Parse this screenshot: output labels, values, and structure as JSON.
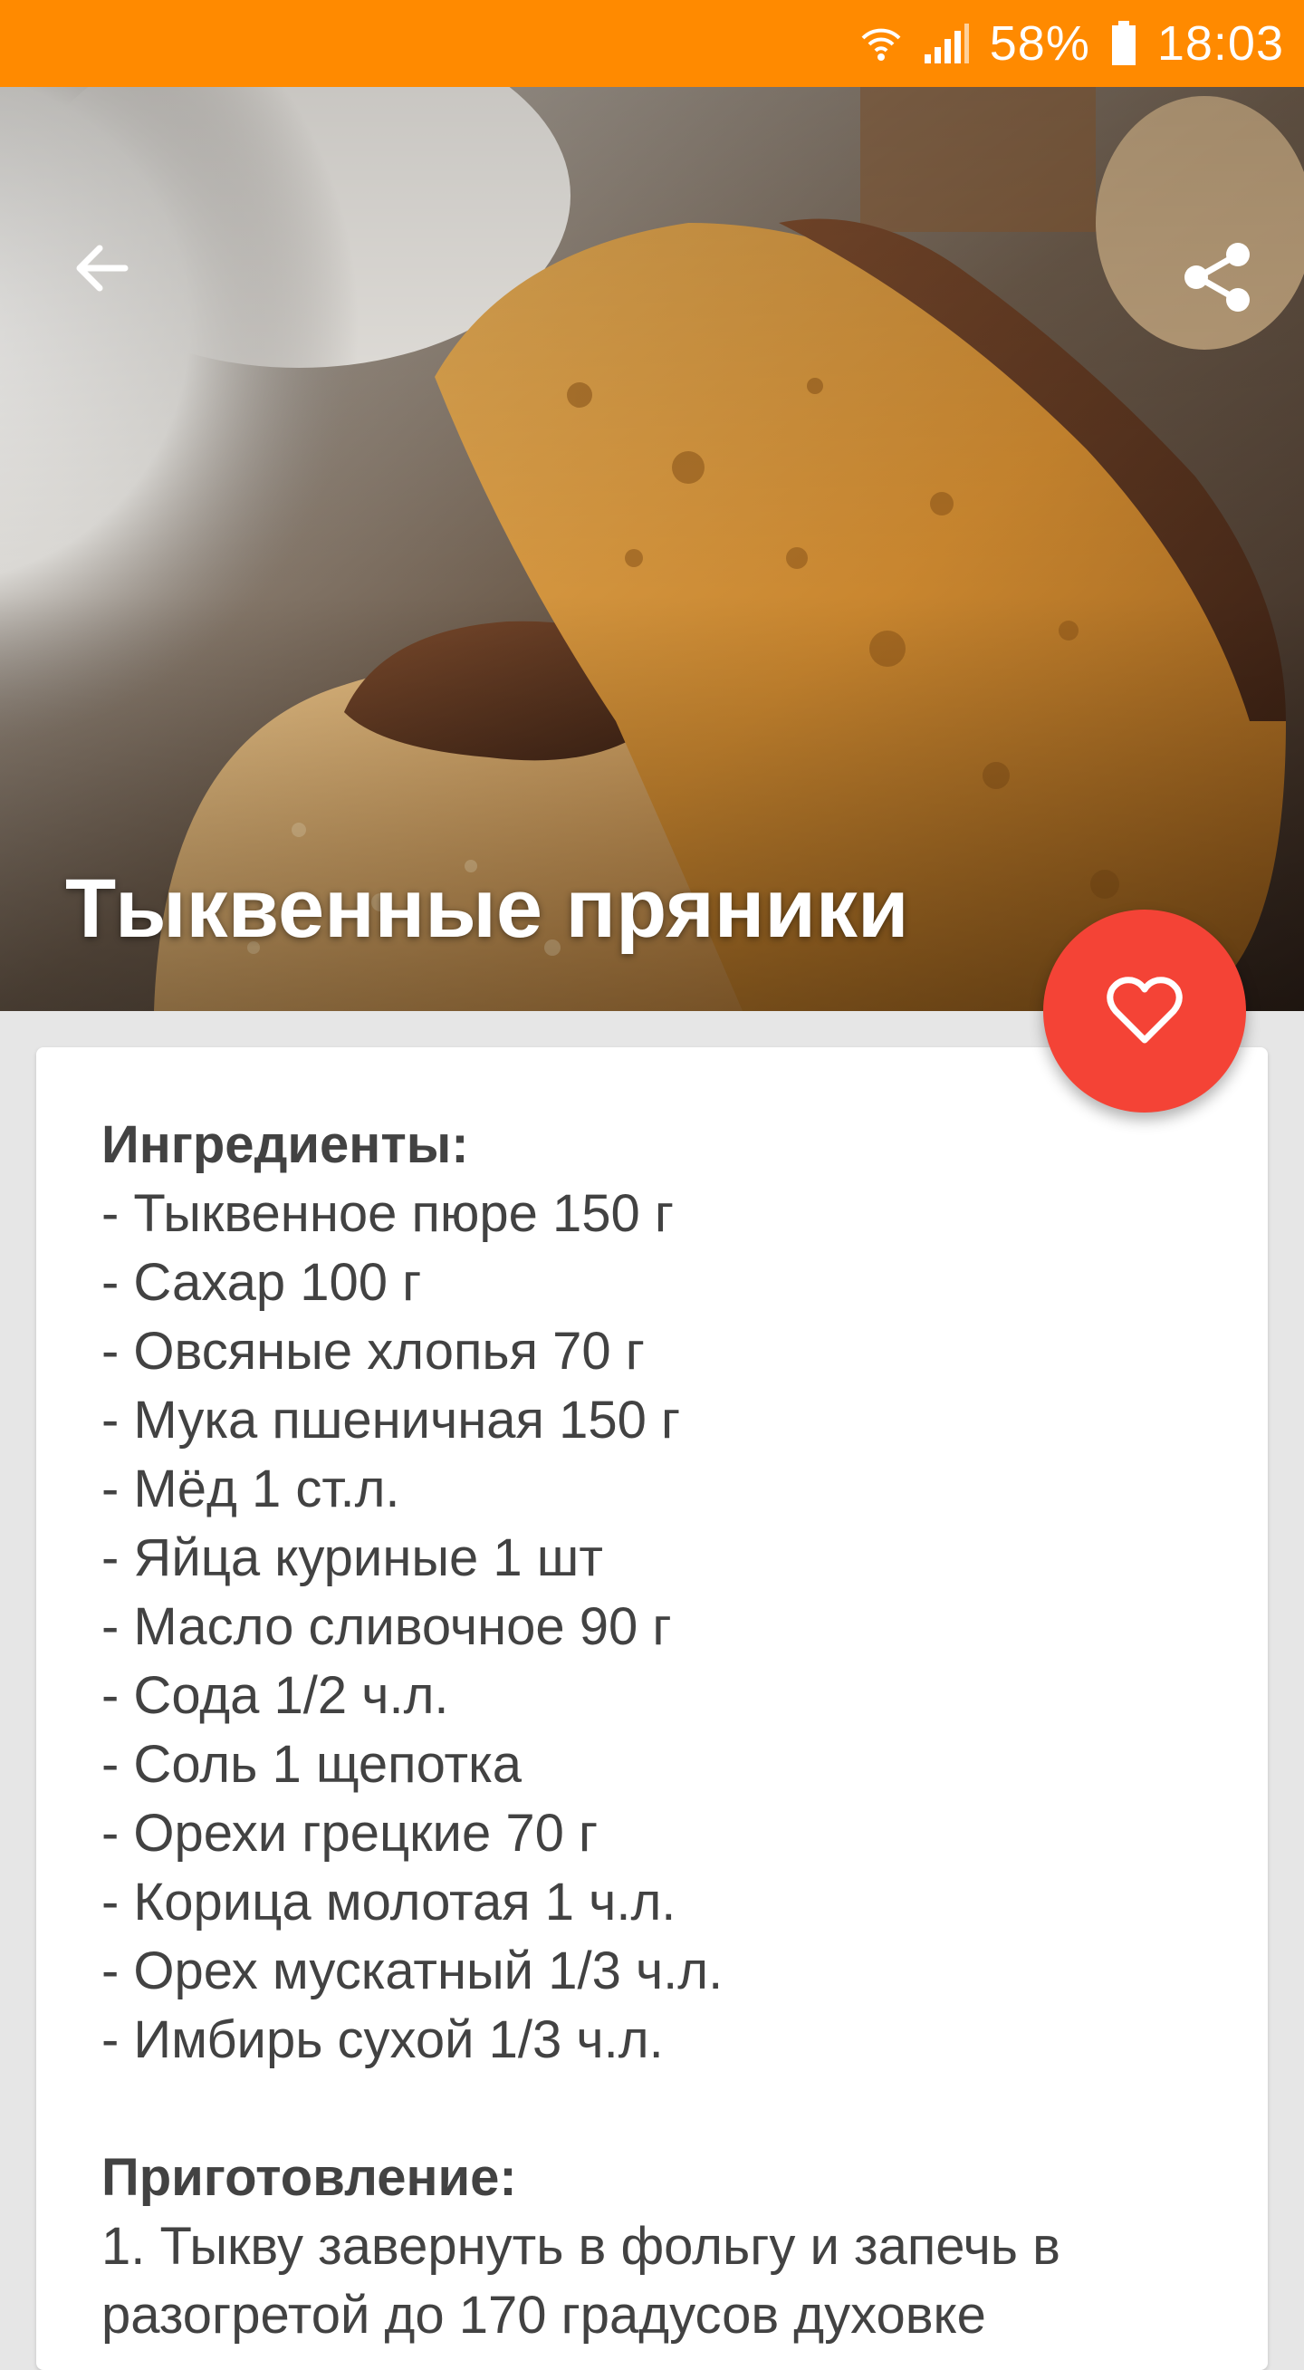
{
  "status_bar": {
    "battery_percent": "58%",
    "time": "18:03",
    "icons": [
      "wifi-icon",
      "signal-icon",
      "battery-icon"
    ],
    "background_color": "#ff8a00"
  },
  "toolbar": {
    "back_icon": "arrow-back-icon",
    "share_icon": "share-icon"
  },
  "recipe": {
    "title": "Тыквенные пряники",
    "favorite_icon": "heart-outline-icon",
    "favorite_color": "#f44336",
    "ingredients_heading": "Ингредиенты:",
    "ingredients": [
      "- Тыквенное пюре 150 г",
      "- Сахар 100 г",
      "- Овсяные хлопья 70 г",
      "- Мука пшеничная 150 г",
      "- Мёд 1 ст.л.",
      "- Яйца куриные 1 шт",
      "- Масло сливочное 90 г",
      "- Сода 1/2 ч.л.",
      "- Соль 1 щепотка",
      "- Орехи грецкие 70 г",
      "- Корица молотая 1 ч.л.",
      "- Орех мускатный 1/3 ч.л.",
      "- Имбирь сухой 1/3 ч.л."
    ],
    "preparation_heading": "Приготовление:",
    "preparation_text": "1. Тыкву завернуть в фольгу и запечь в разогретой до 170 градусов духовке"
  }
}
